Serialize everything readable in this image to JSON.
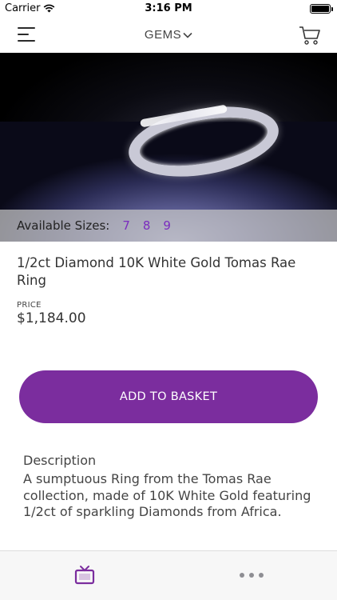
{
  "status_bar": {
    "carrier": "Carrier",
    "time": "3:16 PM"
  },
  "nav": {
    "title": "GEMS",
    "menu_icon": "hamburger-menu-icon",
    "cart_icon": "shopping-cart-icon"
  },
  "product": {
    "image_alt": "ring",
    "sizes_label": "Available Sizes:",
    "sizes": [
      "7",
      "8",
      "9"
    ],
    "name": "1/2ct Diamond 10K White Gold Tomas Rae Ring",
    "price_label": "PRICE",
    "price": "$1,184.00"
  },
  "actions": {
    "add_to_basket": "ADD TO BASKET"
  },
  "description": {
    "heading": "Description",
    "body": "A sumptuous Ring from the Tomas Rae collection, made of 10K White Gold featuring 1/2ct of sparkling Diamonds from Africa."
  },
  "tab_bar": {
    "tv_icon": "tv-icon",
    "more_icon": "more-dots-icon"
  },
  "colors": {
    "accent": "#7b2d9e",
    "size_link": "#7b2cbf"
  }
}
